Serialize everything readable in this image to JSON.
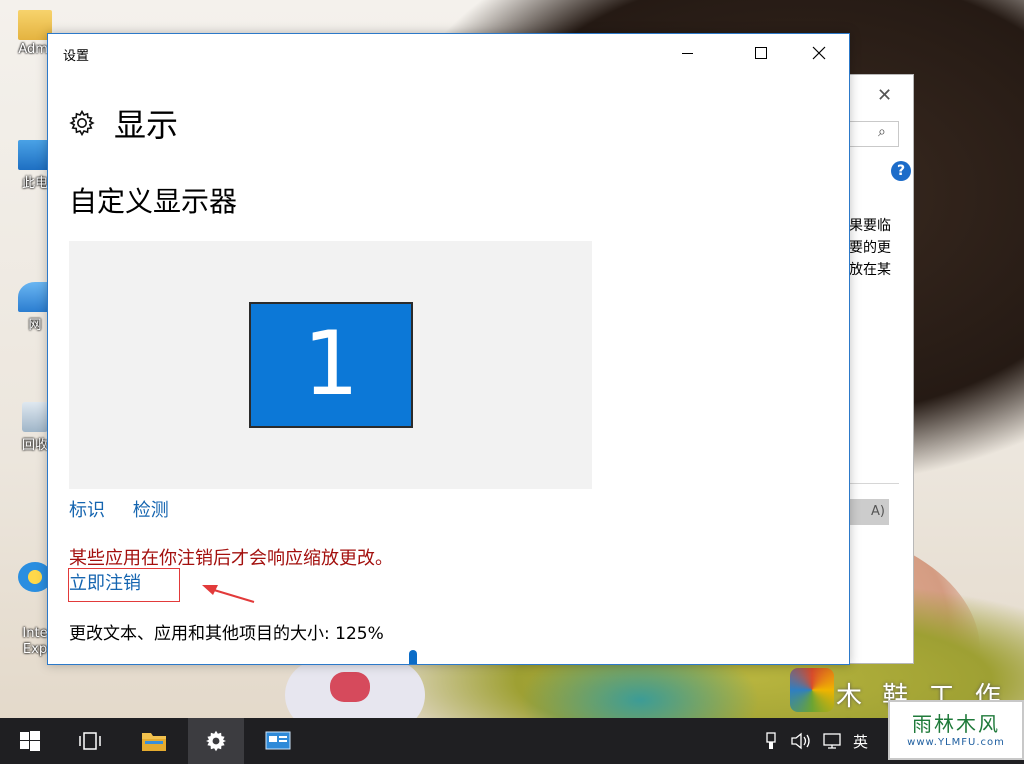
{
  "window": {
    "title": "设置",
    "page_title": "显示",
    "section_title": "自定义显示器",
    "monitor_number": "1",
    "links": {
      "identify": "标识",
      "detect": "检测"
    },
    "warning": "某些应用在你注销后才会响应缩放更改。",
    "signout": "立即注销",
    "scale_text": "更改文本、应用和其他项目的大小: 125%"
  },
  "background_window": {
    "text_lines": "果要临\n要的更\n放在某",
    "button_label": "A)"
  },
  "desktop": {
    "icons": [
      {
        "label": "Admi"
      },
      {
        "label": "此电"
      },
      {
        "label": "网"
      },
      {
        "label": "回收"
      },
      {
        "label": "Inte\nExp"
      }
    ],
    "watermark_text": "木 鞋 工 作 室"
  },
  "taskbar": {
    "tray_lang": "英",
    "watermark_main": "雨林木风",
    "watermark_sub": "www.YLMFU.com"
  },
  "colors": {
    "accent": "#0c78d7",
    "warning": "#a3100e",
    "link": "#1565b0",
    "taskbar": "#1f1f22"
  }
}
